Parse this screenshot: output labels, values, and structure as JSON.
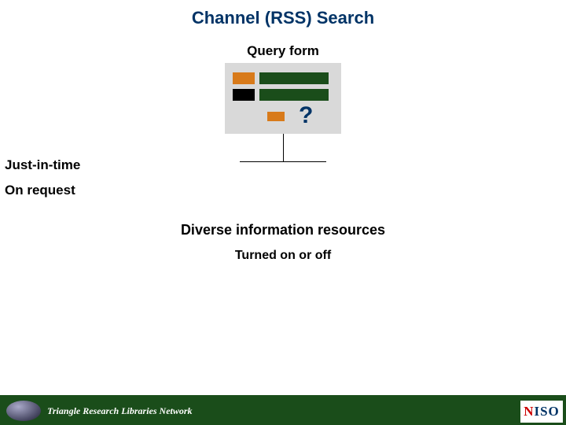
{
  "title": "Channel (RSS) Search",
  "query_label": "Query form",
  "question_mark": "?",
  "left_labels": {
    "jit": "Just-in-time",
    "on_request": "On request"
  },
  "center_labels": {
    "diverse": "Diverse information resources",
    "turned": "Turned on or off"
  },
  "footer": {
    "org": "Triangle Research Libraries Network",
    "niso_n": "N",
    "niso_iso": "ISO"
  },
  "swatches": {
    "orange": "#d87a1a",
    "green": "#1a4d1a",
    "black": "#000000",
    "grey": "#d9d9d9"
  }
}
